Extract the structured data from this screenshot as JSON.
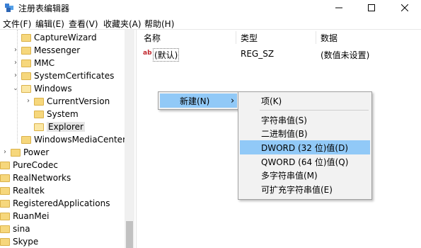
{
  "window": {
    "title": "注册表编辑器",
    "controls": {
      "minimize": "—",
      "maximize": "☐",
      "close": "✕"
    }
  },
  "menubar": [
    {
      "label": "文件(F)"
    },
    {
      "label": "编辑(E)"
    },
    {
      "label": "查看(V)"
    },
    {
      "label": "收藏夹(A)"
    },
    {
      "label": "帮助(H)"
    }
  ],
  "tree": {
    "items": [
      {
        "label": "CaptureWizard"
      },
      {
        "label": "Messenger"
      },
      {
        "label": "MMC"
      },
      {
        "label": "SystemCertificates"
      },
      {
        "label": "Windows"
      },
      {
        "label": "CurrentVersion"
      },
      {
        "label": "System"
      },
      {
        "label": "Explorer"
      },
      {
        "label": "WindowsMediaCenter"
      },
      {
        "label": "Power"
      },
      {
        "label": "PureCodec"
      },
      {
        "label": "RealNetworks"
      },
      {
        "label": "Realtek"
      },
      {
        "label": "RegisteredApplications"
      },
      {
        "label": "RuanMei"
      },
      {
        "label": "sina"
      },
      {
        "label": "Skype"
      }
    ]
  },
  "list": {
    "columns": [
      "名称",
      "类型",
      "数据"
    ],
    "rows": [
      {
        "icon": "string-value-icon",
        "name": "(默认)",
        "type": "REG_SZ",
        "data": "(数值未设置)"
      }
    ]
  },
  "context_menu": {
    "new_label": "新建(N)",
    "arrow": "›"
  },
  "submenu": {
    "items": [
      {
        "label": "项(K)"
      },
      {
        "label": "字符串值(S)"
      },
      {
        "label": "二进制值(B)"
      },
      {
        "label": "DWORD (32 位)值(D)"
      },
      {
        "label": "QWORD (64 位)值(Q)"
      },
      {
        "label": "多字符串值(M)"
      },
      {
        "label": "可扩充字符串值(E)"
      }
    ]
  },
  "colors": {
    "highlight": "#91c9f7",
    "folder": "#f6d77c"
  }
}
